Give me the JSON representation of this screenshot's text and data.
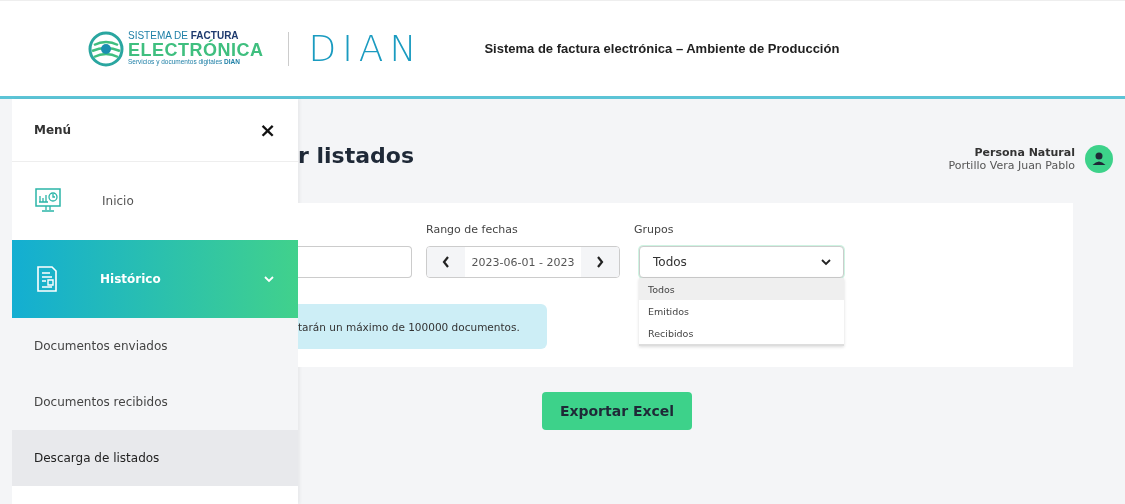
{
  "header": {
    "logo": {
      "line1": "SISTEMA DE **FACTURA**",
      "line2": "ELECTRÓNICA",
      "line3": "Servicios y documentos digitales **DIAN**"
    },
    "brand": "DIAN",
    "title": "Sistema de factura electrónica – Ambiente de Producción"
  },
  "sidebar": {
    "title": "Menú",
    "close": "×",
    "items": [
      {
        "label": "Inicio",
        "kind": "monitor",
        "selected": false
      },
      {
        "label": "Histórico",
        "kind": "document",
        "selected": true,
        "expanded": true,
        "children": [
          {
            "label": "Documentos enviados",
            "selected": false
          },
          {
            "label": "Documentos recibidos",
            "selected": false
          },
          {
            "label": "Descarga de listados",
            "selected": true
          }
        ]
      }
    ]
  },
  "page": {
    "title": "r listados"
  },
  "user": {
    "role": "Persona Natural",
    "name": "Portillo Vera Juan Pablo"
  },
  "filters": {
    "date_range": {
      "label": "Rango de fechas",
      "value": "2023-06-01 - 2023"
    },
    "groups": {
      "label": "Grupos",
      "value": "Todos",
      "expanded": true,
      "options": [
        {
          "label": "Todos",
          "selected": true
        },
        {
          "label": "Emitidos",
          "selected": false
        },
        {
          "label": "Recibidos",
          "selected": false
        }
      ]
    }
  },
  "info": "tarán un máximo de 100000 documentos.",
  "export_button": "Exportar Excel"
}
